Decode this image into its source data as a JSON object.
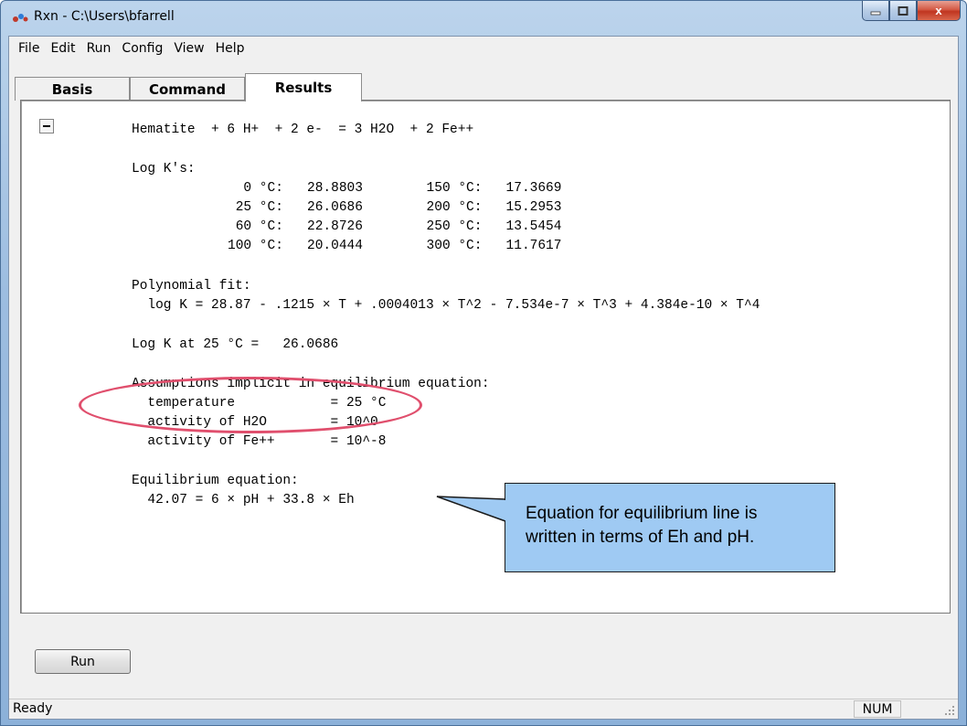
{
  "window": {
    "title": "Rxn - C:\\Users\\bfarrell",
    "close_glyph": "x"
  },
  "menu": [
    "File",
    "Edit",
    "Run",
    "Config",
    "View",
    "Help"
  ],
  "tabs": [
    {
      "label": "Basis"
    },
    {
      "label": "Command"
    },
    {
      "label": "Results"
    }
  ],
  "results": {
    "reaction": "Hematite  + 6 H+  + 2 e-  = 3 H2O  + 2 Fe++",
    "logk_heading": "Log K's:",
    "logk_rows": [
      "  0 °C:   28.8803        150 °C:   17.3669",
      " 25 °C:   26.0686        200 °C:   15.2953",
      " 60 °C:   22.8726        250 °C:   13.5454",
      "100 °C:   20.0444        300 °C:   11.7617"
    ],
    "poly_heading": "Polynomial fit:",
    "poly_eq": "  log K = 28.87 - .1215 × T + .0004013 × T^2 - 7.534e-7 × T^3 + 4.384e-10 × T^4",
    "logk25": "Log K at 25 °C =   26.0686",
    "assump_heading": "Assumptions implicit in equilibrium equation:",
    "assump_rows": [
      "  temperature            = 25 °C",
      "  activity of H2O        = 10^0",
      "  activity of Fe++       = 10^-8"
    ],
    "eq_heading": "Equilibrium equation:",
    "eq_line": "  42.07 = 6 × pH + 33.8 × Eh"
  },
  "callout": {
    "line1": "Equation for equilibrium line is",
    "line2": "written in terms of Eh and pH."
  },
  "buttons": {
    "run": "Run"
  },
  "status": {
    "text": "Ready",
    "num": "NUM"
  },
  "colors": {
    "highlight": "#e04f6d",
    "callout_fill": "#9fcaf3"
  }
}
